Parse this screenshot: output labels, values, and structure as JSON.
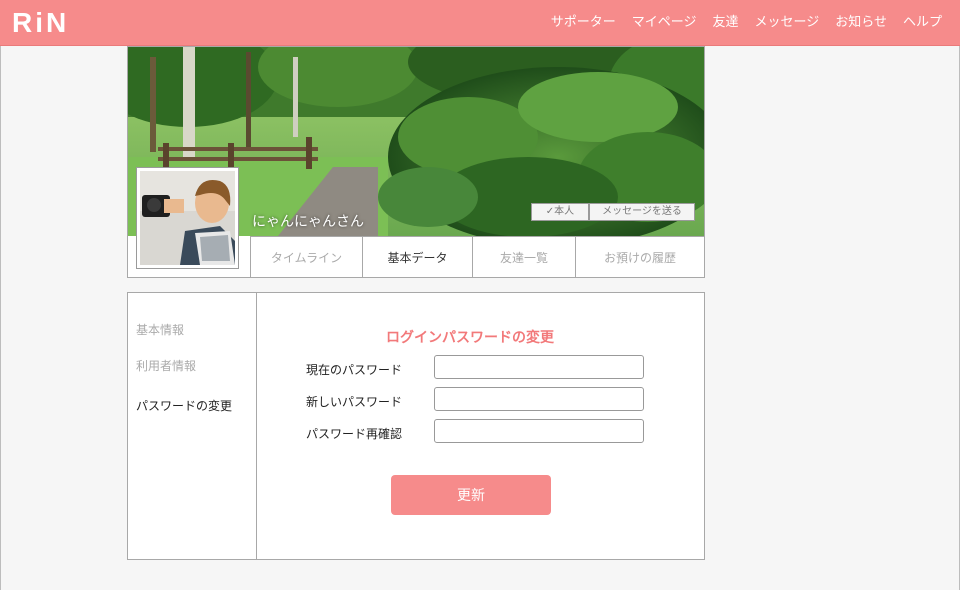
{
  "header": {
    "logo": "RiN",
    "nav": [
      "サポーター",
      "マイページ",
      "友達",
      "メッセージ",
      "お知らせ",
      "ヘルプ"
    ]
  },
  "profile": {
    "username": "にゃんにゃんさん",
    "self_button": "✓本人",
    "message_button": "メッセージを送る",
    "tabs": [
      "タイムライン",
      "基本データ",
      "友達一覧",
      "お預けの履歴"
    ],
    "active_tab": "基本データ"
  },
  "settings_menu": {
    "items": [
      "基本情報",
      "利用者情報",
      "パスワードの変更"
    ],
    "active": "パスワードの変更"
  },
  "password_form": {
    "title": "ログインパスワードの変更",
    "current_label": "現在のパスワード",
    "current_value": "",
    "new_label": "新しいパスワード",
    "new_value": "",
    "confirm_label": "パスワード再確認",
    "confirm_value": "",
    "submit_label": "更新"
  },
  "colors": {
    "brand": "#f68b8b",
    "title_accent": "#f2797a"
  }
}
